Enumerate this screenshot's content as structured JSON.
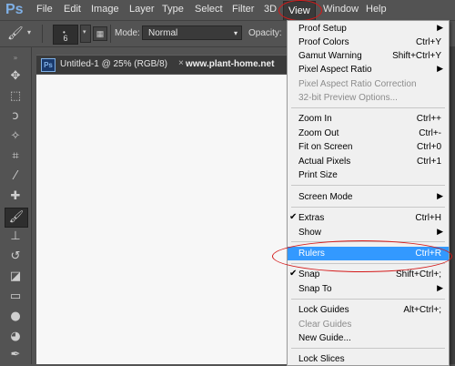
{
  "app": {
    "logo": "Ps",
    "menus": [
      "File",
      "Edit",
      "Image",
      "Layer",
      "Type",
      "Select",
      "Filter",
      "3D",
      "View",
      "Window",
      "Help"
    ],
    "active_menu": "View"
  },
  "options_bar": {
    "brush_size": "6",
    "mode_label": "Mode:",
    "mode_value": "Normal",
    "opacity_label": "Opacity:"
  },
  "document": {
    "logo": "Ps",
    "tab_title": "Untitled-1 @ 25% (RGB/8)",
    "close": "×",
    "watermark": "www.plant-home.net"
  },
  "view_menu": {
    "items": [
      {
        "label": "Proof Setup",
        "shortcut": "",
        "submenu": true,
        "disabled": false,
        "checked": false
      },
      {
        "label": "Proof Colors",
        "shortcut": "Ctrl+Y",
        "submenu": false,
        "disabled": false,
        "checked": false
      },
      {
        "label": "Gamut Warning",
        "shortcut": "Shift+Ctrl+Y",
        "submenu": false,
        "disabled": false,
        "checked": false
      },
      {
        "label": "Pixel Aspect Ratio",
        "shortcut": "",
        "submenu": true,
        "disabled": false,
        "checked": false
      },
      {
        "label": "Pixel Aspect Ratio Correction",
        "shortcut": "",
        "submenu": false,
        "disabled": true,
        "checked": false
      },
      {
        "label": "32-bit Preview Options...",
        "shortcut": "",
        "submenu": false,
        "disabled": true,
        "checked": false
      },
      {
        "label": "Zoom In",
        "shortcut": "Ctrl++",
        "submenu": false,
        "disabled": false,
        "checked": false
      },
      {
        "label": "Zoom Out",
        "shortcut": "Ctrl+-",
        "submenu": false,
        "disabled": false,
        "checked": false
      },
      {
        "label": "Fit on Screen",
        "shortcut": "Ctrl+0",
        "submenu": false,
        "disabled": false,
        "checked": false
      },
      {
        "label": "Actual Pixels",
        "shortcut": "Ctrl+1",
        "submenu": false,
        "disabled": false,
        "checked": false
      },
      {
        "label": "Print Size",
        "shortcut": "",
        "submenu": false,
        "disabled": false,
        "checked": false
      },
      {
        "label": "Screen Mode",
        "shortcut": "",
        "submenu": true,
        "disabled": false,
        "checked": false
      },
      {
        "label": "Extras",
        "shortcut": "Ctrl+H",
        "submenu": false,
        "disabled": false,
        "checked": true
      },
      {
        "label": "Show",
        "shortcut": "",
        "submenu": true,
        "disabled": false,
        "checked": false
      },
      {
        "label": "Rulers",
        "shortcut": "Ctrl+R",
        "submenu": false,
        "disabled": false,
        "checked": false,
        "highlighted": true
      },
      {
        "label": "Snap",
        "shortcut": "Shift+Ctrl+;",
        "submenu": false,
        "disabled": false,
        "checked": true
      },
      {
        "label": "Snap To",
        "shortcut": "",
        "submenu": true,
        "disabled": false,
        "checked": false
      },
      {
        "label": "Lock Guides",
        "shortcut": "Alt+Ctrl+;",
        "submenu": false,
        "disabled": false,
        "checked": false
      },
      {
        "label": "Clear Guides",
        "shortcut": "",
        "submenu": false,
        "disabled": true,
        "checked": false
      },
      {
        "label": "New Guide...",
        "shortcut": "",
        "submenu": false,
        "disabled": false,
        "checked": false
      },
      {
        "label": "Lock Slices",
        "shortcut": "",
        "submenu": false,
        "disabled": false,
        "checked": false
      }
    ]
  },
  "colors": {
    "ui_dark": "#535353",
    "menu_bg": "#f0f0f0",
    "highlight": "#3399ff",
    "annotation_red": "#d41919",
    "ps_blue": "#7fb0e6"
  }
}
